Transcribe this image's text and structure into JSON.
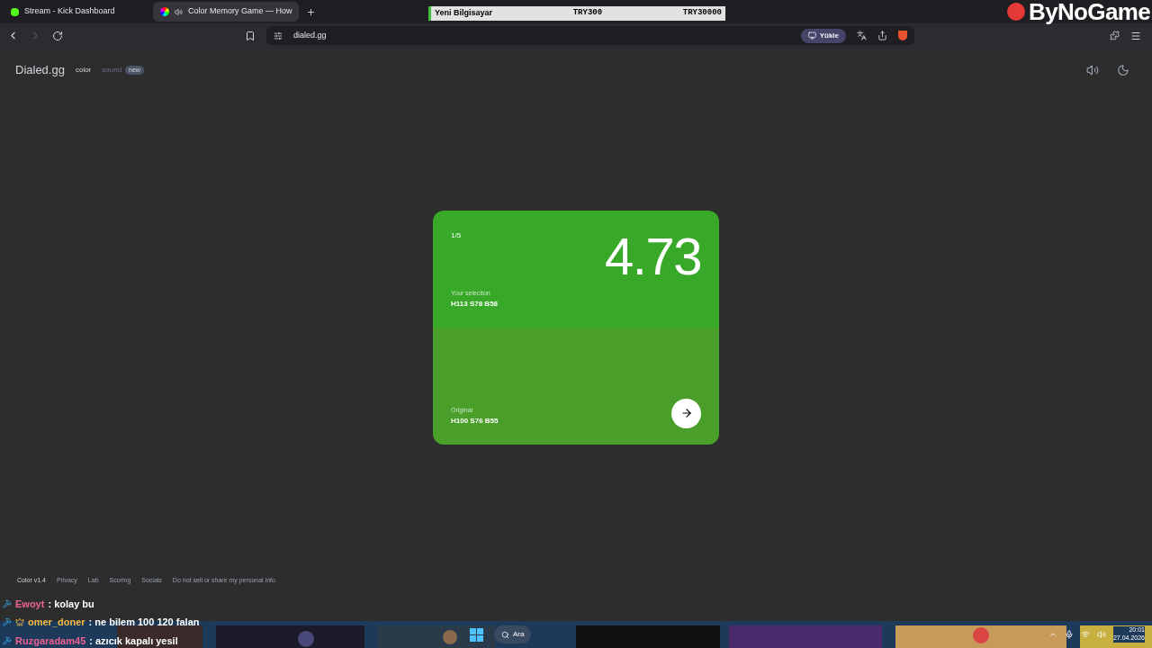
{
  "browser": {
    "tabs": [
      {
        "title": "Stream - Kick Dashboard",
        "selected": false,
        "audio": false
      },
      {
        "title": "Color Memory Game — How",
        "selected": true,
        "audio": true
      }
    ],
    "address": "dialed.gg",
    "install_label": "Yükle"
  },
  "ticker": {
    "item": "Yeni Bilgisayar",
    "min": "TRY300",
    "max": "TRY30000"
  },
  "logo": "ByNoGame",
  "site": {
    "brand": "Dialed.gg",
    "nav": [
      {
        "label": "color",
        "selected": true
      },
      {
        "label": "sound",
        "selected": false,
        "badge": "new"
      }
    ]
  },
  "card": {
    "round": "1/5",
    "score": "4.73",
    "swatches": [
      {
        "label": "Your selection",
        "value": "H113 S78 B58",
        "color": "#37a827"
      },
      {
        "label": "Original",
        "value": "H100 S76 B55",
        "color": "#4a9e2a"
      }
    ]
  },
  "footer": [
    "Color v1.4",
    "Privacy",
    "Lab",
    "Scoring",
    "Socials",
    "Do not sell or share my personal info"
  ],
  "chat": [
    {
      "user": "Ewoyt",
      "message": ": kolay bu",
      "color": "#f06292"
    },
    {
      "user": "omer_doner",
      "message": ": ne bilem 100 120 falan",
      "color": "#f5b942"
    },
    {
      "user": "Ruzgaradam45",
      "message": ": azıcık kapalı yesil",
      "color": "#f06292"
    }
  ],
  "taskbar": {
    "search": "Ara",
    "time": "20:01",
    "date": "27.04.2026"
  }
}
